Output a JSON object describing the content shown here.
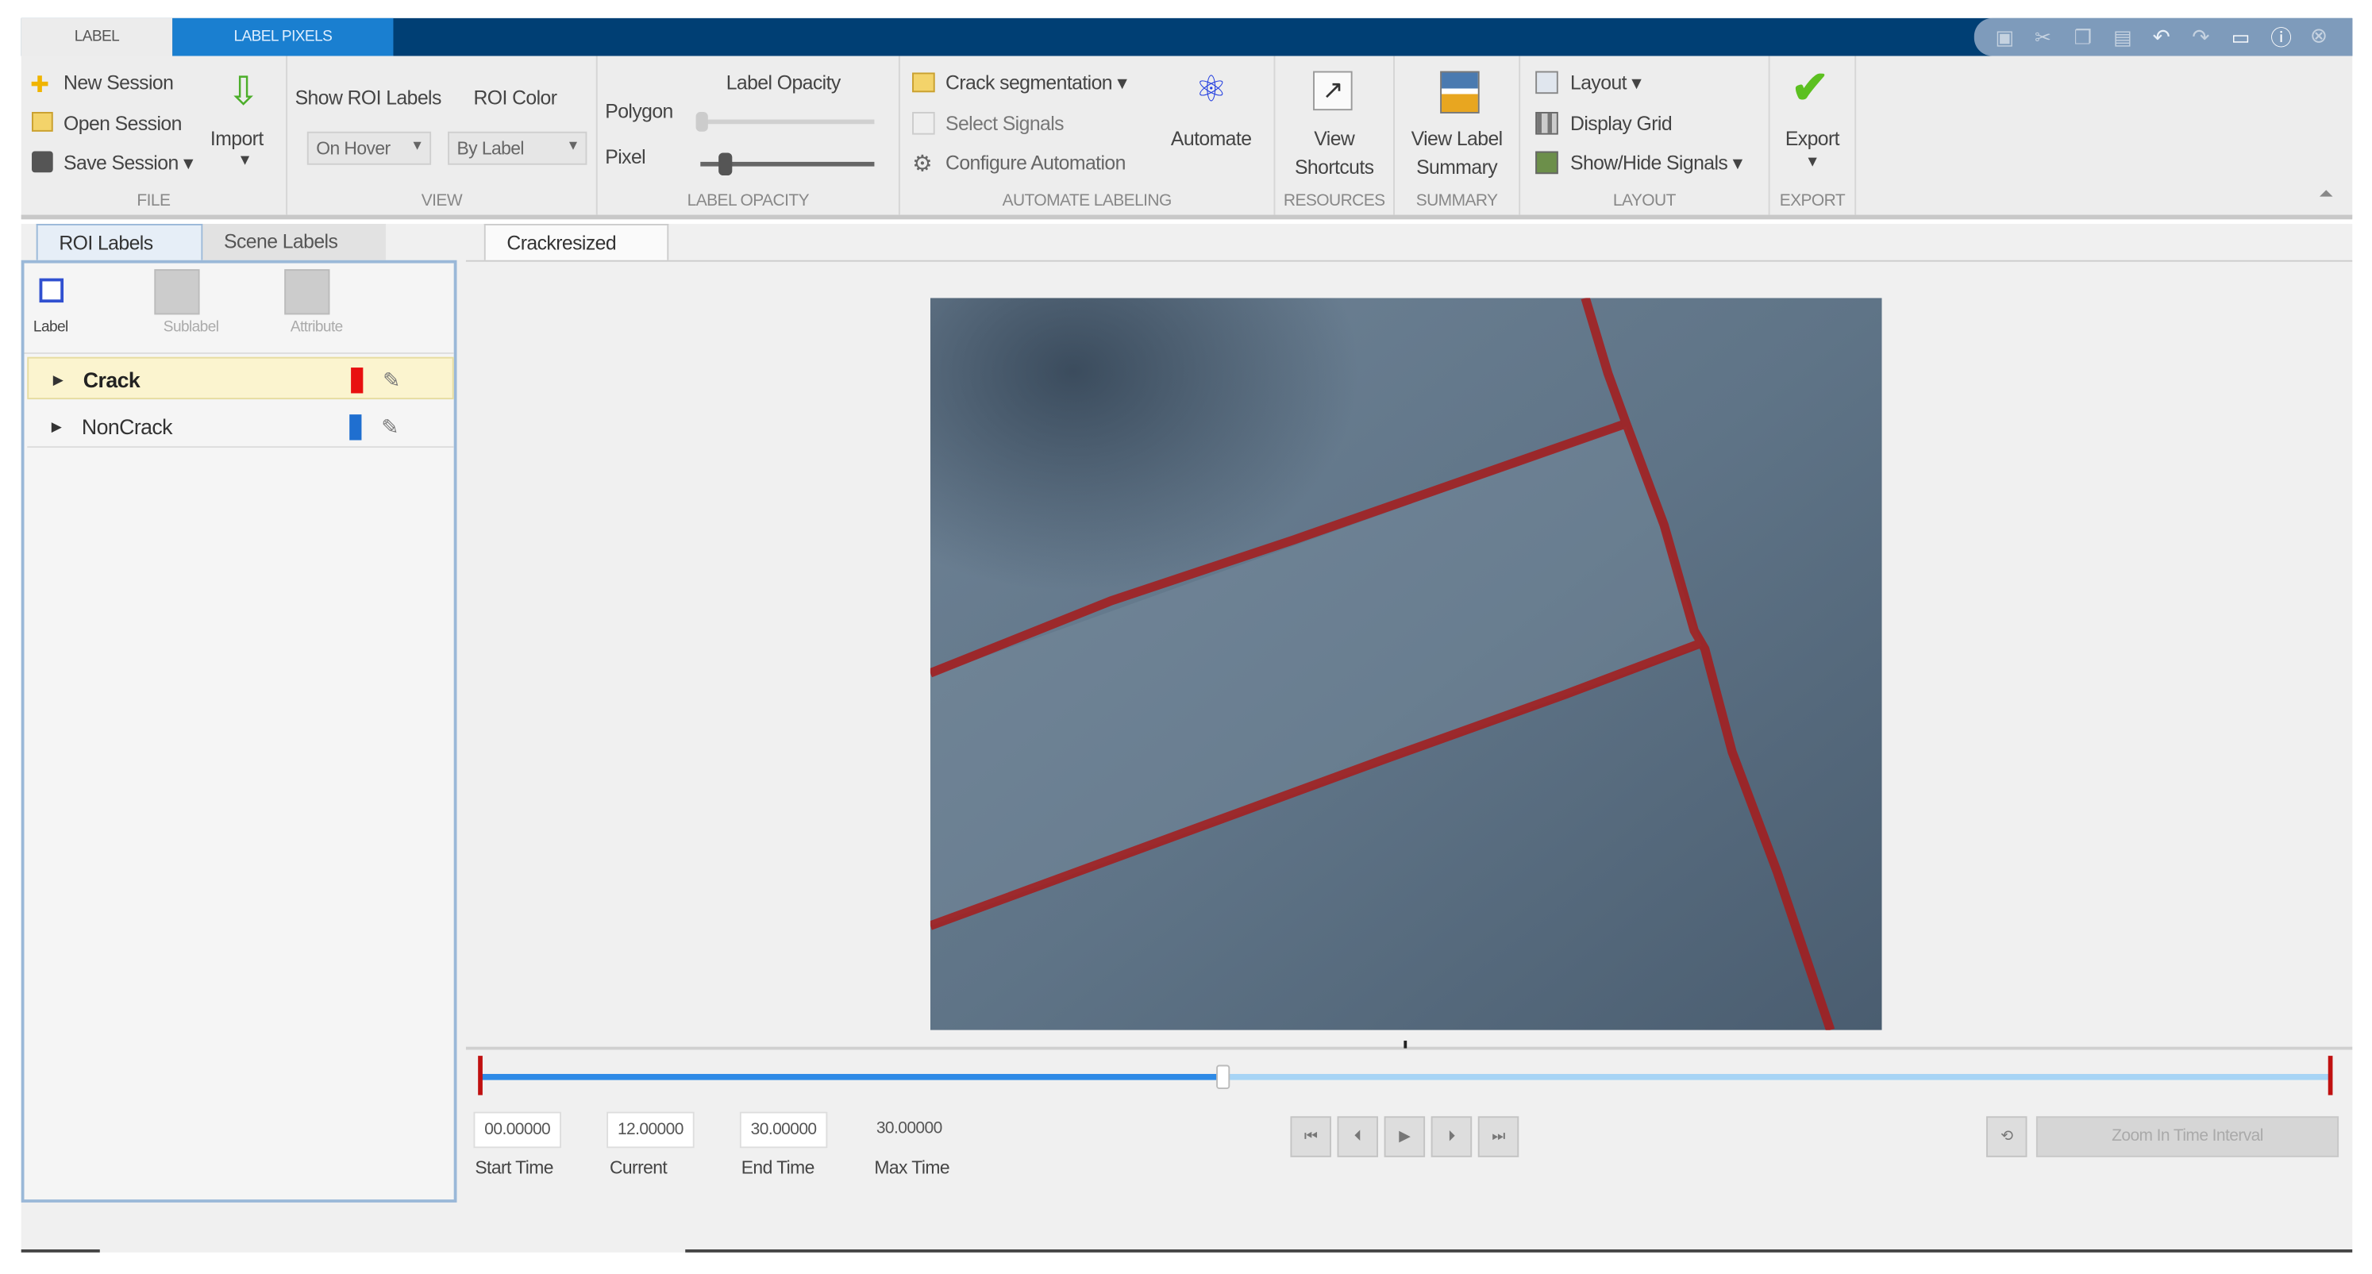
{
  "tabs": {
    "label": "LABEL",
    "label_pixels": "LABEL PIXELS"
  },
  "file": {
    "new_session": "New Session",
    "open_session": "Open Session",
    "save_session": "Save Session",
    "import": "Import",
    "section": "FILE"
  },
  "view": {
    "show_roi_labels": "Show ROI Labels",
    "roi_color": "ROI Color",
    "show_value": "On Hover",
    "color_value": "By Label",
    "section": "VIEW"
  },
  "opacity": {
    "title": "Label Opacity",
    "polygon": "Polygon",
    "pixel": "Pixel",
    "polygon_value": 0.0,
    "pixel_value": 0.15,
    "section": "LABEL OPACITY"
  },
  "automate": {
    "algorithm": "Crack segmentation",
    "select_signals": "Select Signals",
    "configure": "Configure Automation",
    "automate": "Automate",
    "section": "AUTOMATE LABELING"
  },
  "resources": {
    "view_shortcuts_1": "View",
    "view_shortcuts_2": "Shortcuts",
    "section": "RESOURCES"
  },
  "summary": {
    "label_1": "View Label",
    "label_2": "Summary",
    "section": "SUMMARY"
  },
  "layout": {
    "layout": "Layout",
    "display_grid": "Display Grid",
    "show_hide": "Show/Hide Signals",
    "section": "LAYOUT"
  },
  "export": {
    "label": "Export",
    "section": "EXPORT"
  },
  "left_panel": {
    "tab_roi": "ROI Labels",
    "tab_scene": "Scene Labels",
    "tool_label": "Label",
    "tool_sublabel": "Sublabel",
    "tool_attribute": "Attribute",
    "labels": [
      {
        "name": "Crack",
        "color": "#e81010"
      },
      {
        "name": "NonCrack",
        "color": "#1f6fd0"
      }
    ]
  },
  "document": {
    "tab": "Crackresized"
  },
  "timeline": {
    "start": "00.00000",
    "current": "12.00000",
    "end": "30.00000",
    "max": "30.00000",
    "start_label": "Start Time",
    "current_label": "Current",
    "end_label": "End Time",
    "max_label": "Max Time",
    "progress": 0.4,
    "zoom_button": "Zoom In Time Interval"
  },
  "colors": {
    "accent": "#1a7fd0",
    "titlebar": "#003f74",
    "crack": "#b01818"
  }
}
